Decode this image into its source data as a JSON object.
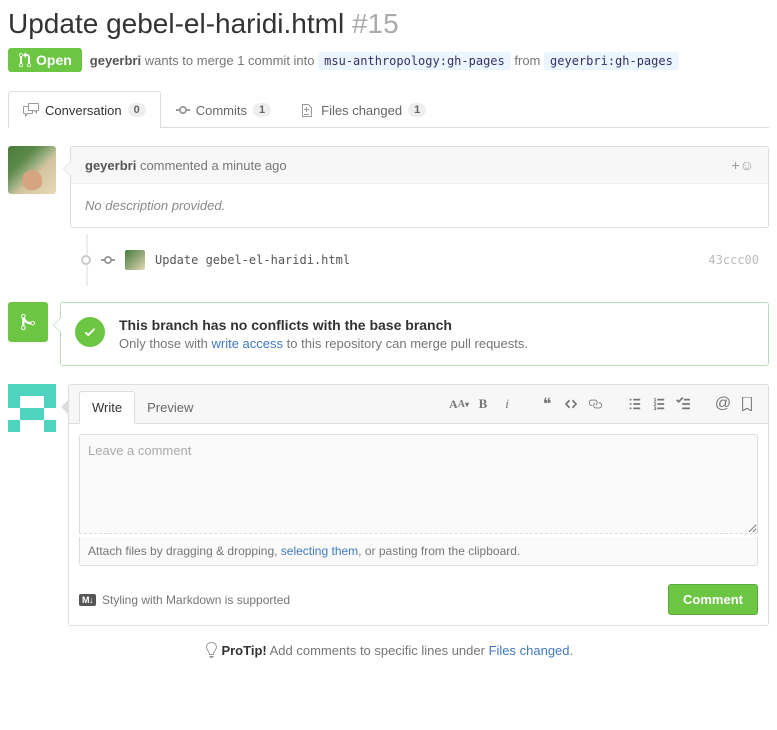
{
  "header": {
    "title": "Update gebel-el-haridi.html",
    "number": "#15",
    "state": "Open",
    "merge_user": "geyerbri",
    "merge_text_1": "wants to merge 1 commit into",
    "base_ref": "msu-anthropology:gh-pages",
    "merge_text_2": "from",
    "head_ref": "geyerbri:gh-pages"
  },
  "tabs": {
    "conversation": {
      "label": "Conversation",
      "count": "0"
    },
    "commits": {
      "label": "Commits",
      "count": "1"
    },
    "files": {
      "label": "Files changed",
      "count": "1"
    }
  },
  "comment": {
    "author": "geyerbri",
    "verb": "commented",
    "time": "a minute ago",
    "body": "No description provided."
  },
  "commit": {
    "message": "Update gebel-el-haridi.html",
    "sha": "43ccc00"
  },
  "merge": {
    "title": "This branch has no conflicts with the base branch",
    "subtitle_1": "Only those with",
    "link": "write access",
    "subtitle_2": "to this repository can merge pull requests."
  },
  "compose": {
    "write": "Write",
    "preview": "Preview",
    "placeholder": "Leave a comment",
    "attach_1": "Attach files by dragging & dropping,",
    "attach_link": "selecting them",
    "attach_2": ", or pasting from the clipboard.",
    "md_hint": "Styling with Markdown is supported",
    "submit": "Comment"
  },
  "protip": {
    "label": "ProTip!",
    "text": "Add comments to specific lines under",
    "link": "Files changed"
  }
}
